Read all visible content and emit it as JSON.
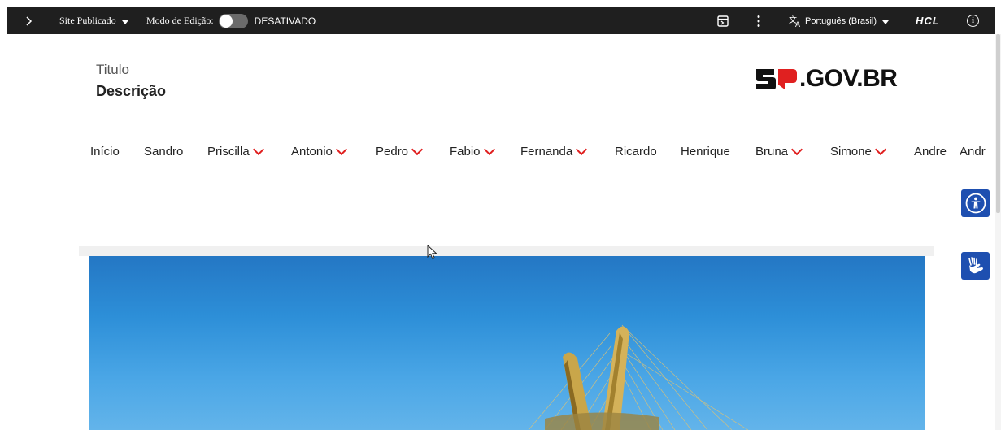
{
  "toolbar": {
    "expand_icon": "chevron-right-icon",
    "site_status": "Site Publicado",
    "edit_mode_label": "Modo de Edição:",
    "edit_mode_state": "DESATIVADO",
    "language": "Português (Brasil)",
    "brand": "HCL"
  },
  "header": {
    "title": "Titulo",
    "description": "Descrição",
    "logo_text": ".GOV.BR"
  },
  "nav": {
    "items": [
      {
        "label": "Início",
        "dropdown": false
      },
      {
        "label": "Sandro",
        "dropdown": false
      },
      {
        "label": "Priscilla",
        "dropdown": true
      },
      {
        "label": "Antonio",
        "dropdown": true
      },
      {
        "label": "Pedro",
        "dropdown": true
      },
      {
        "label": "Fabio",
        "dropdown": true
      },
      {
        "label": "Fernanda",
        "dropdown": true
      },
      {
        "label": "Ricardo",
        "dropdown": false
      },
      {
        "label": "Henrique",
        "dropdown": false
      },
      {
        "label": "Bruna",
        "dropdown": true
      },
      {
        "label": "Simone",
        "dropdown": true
      },
      {
        "label": "Andre",
        "dropdown": false
      },
      {
        "label": "Andr",
        "dropdown": false
      }
    ]
  },
  "accessibility": {
    "accessibility_icon": "accessibility-icon",
    "sign_language_icon": "sign-language-icon"
  },
  "colors": {
    "toolbar_bg": "#1f1f1f",
    "accent_red": "#e02020",
    "accessibility_blue": "#1e4fb0"
  }
}
